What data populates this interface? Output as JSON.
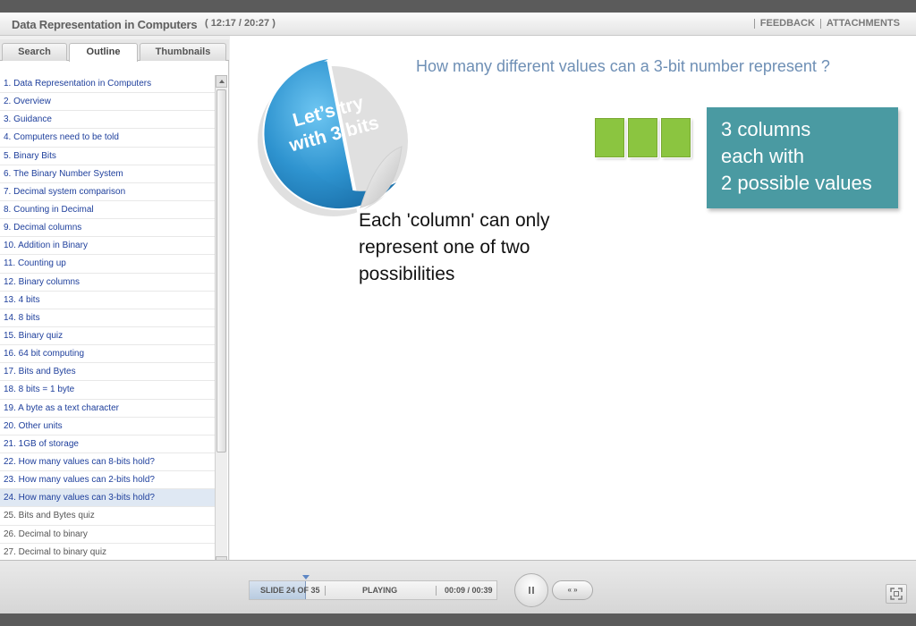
{
  "header": {
    "title": "Data Representation in Computers",
    "time": "( 12:17 / 20:27 )",
    "links": [
      "FEEDBACK",
      "ATTACHMENTS"
    ]
  },
  "sidebar": {
    "tabs": [
      "Search",
      "Outline",
      "Thumbnails"
    ],
    "active_tab": "Outline",
    "items": [
      "1. Data Representation in Computers",
      "2. Overview",
      "3. Guidance",
      "4. Computers need to be told",
      "5. Binary Bits",
      "6. The Binary Number System",
      "7. Decimal system comparison",
      "8. Counting in Decimal",
      "9. Decimal columns",
      "10. Addition in Binary",
      "11. Counting up",
      "12. Binary columns",
      "13. 4 bits",
      "14. 8 bits",
      "15. Binary quiz",
      "16. 64 bit computing",
      "17. Bits and Bytes",
      "18. 8 bits = 1 byte",
      "19. A byte as a text character",
      "20. Other units",
      "21. 1GB of storage",
      "22. How many values can 8-bits hold?",
      "23. How many values can 2-bits hold?",
      "24. How many values can 3-bits hold?",
      "25. Bits and Bytes quiz",
      "26. Decimal to binary",
      "27. Decimal to binary quiz"
    ],
    "current_index": 23
  },
  "slide": {
    "question": "How many different values can a 3-bit number represent ?",
    "sticker_lines": [
      "Let’s try",
      "with 3 bits"
    ],
    "bit_count": 3,
    "callout_lines": [
      "3 columns",
      "each with",
      "2 possible values"
    ],
    "body_lines": [
      "Each 'column' can only",
      "represent one of two",
      "possibilities"
    ],
    "colors": {
      "question": "#6e8fb5",
      "bit": "#8bc540",
      "callout": "#4a9aa2",
      "sticker": "#2e93cf"
    }
  },
  "controls": {
    "slide_label": "SLIDE 24 OF 35",
    "status": "PLAYING",
    "elapsed": "00:09 / 00:39",
    "progress_fraction": 0.23,
    "pause_icon": "pause-icon",
    "nav_icons": "prev-next-icon",
    "nav_label": "« »",
    "fullscreen_icon": "fullscreen-icon"
  }
}
